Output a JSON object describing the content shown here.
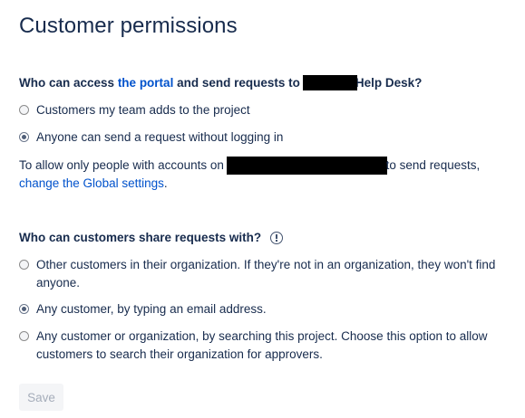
{
  "page": {
    "title": "Customer permissions"
  },
  "access_section": {
    "question_prefix": "Who can access",
    "question_link": "the portal",
    "question_middle": "and send requests to",
    "question_suffix": "Help Desk?",
    "options": [
      {
        "label": "Customers my team adds to the project",
        "selected": false
      },
      {
        "label": "Anyone can send a request without logging in",
        "selected": true
      }
    ],
    "info_prefix": "To allow only people with accounts on",
    "info_suffix": "to send requests,",
    "info_link": "change the Global settings",
    "info_end": "."
  },
  "share_section": {
    "question": "Who can customers share requests with?",
    "info_icon": "warning-circle-icon",
    "options": [
      {
        "label": "Other customers in their organization. If they're not in an organization, they won't find anyone.",
        "selected": false
      },
      {
        "label": "Any customer, by typing an email address.",
        "selected": true
      },
      {
        "label": "Any customer or organization, by searching this project. Choose this option to allow customers to search their organization for approvers.",
        "selected": false
      }
    ]
  },
  "actions": {
    "save_label": "Save",
    "save_disabled": true
  }
}
